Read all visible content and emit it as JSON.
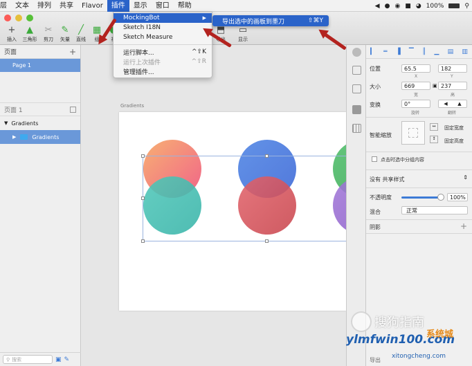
{
  "menubar": {
    "items": [
      "层",
      "文本",
      "排列",
      "共享",
      "Flavor",
      "插件",
      "显示",
      "窗口",
      "帮助"
    ],
    "active_index": 5,
    "battery": "100%"
  },
  "toolbar": {
    "tools": [
      {
        "label": "插入",
        "icon": "plus-icon"
      },
      {
        "label": "三角形",
        "icon": "triangle-icon"
      },
      {
        "label": "剪刀",
        "icon": "scissors-icon"
      },
      {
        "label": "矢量",
        "icon": "vector-pen-icon"
      },
      {
        "label": "直线",
        "icon": "line-icon"
      },
      {
        "label": "组",
        "icon": "group-icon"
      },
      {
        "label": "视",
        "icon": "view-icon"
      },
      {
        "label": "导出",
        "icon": "export-icon"
      },
      {
        "label": "显示",
        "icon": "display-icon"
      }
    ]
  },
  "plugin_menu": {
    "items": [
      {
        "label": "MockingBot",
        "shortcut": "",
        "has_submenu": true,
        "highlighted": true,
        "disabled": false
      },
      {
        "label": "Sketch I18N",
        "shortcut": "",
        "has_submenu": false,
        "highlighted": false,
        "disabled": false
      },
      {
        "label": "Sketch Measure",
        "shortcut": "",
        "has_submenu": false,
        "highlighted": false,
        "disabled": false
      },
      {
        "label": "运行脚本...",
        "shortcut": "^⇧K",
        "has_submenu": false,
        "highlighted": false,
        "disabled": false
      },
      {
        "label": "运行上次插件",
        "shortcut": "^⇧R",
        "has_submenu": false,
        "highlighted": false,
        "disabled": true
      },
      {
        "label": "管理插件...",
        "shortcut": "",
        "has_submenu": false,
        "highlighted": false,
        "disabled": false
      }
    ],
    "submenu": {
      "label": "导出选中的画板到墨刀",
      "shortcut": "⇧⌘Y"
    }
  },
  "left_panel": {
    "pages_title": "页面",
    "page": "Page 1",
    "layers_title": "页面 1",
    "layers": [
      {
        "name": "Gradients",
        "selected": false
      },
      {
        "name": "Gradients",
        "selected": true
      }
    ],
    "search_placeholder": "搜索"
  },
  "canvas": {
    "artboard_name": "Gradients",
    "circles": [
      {
        "group": 1,
        "top": "#f6a560",
        "bottom": "#ef4f78"
      },
      {
        "group": 1,
        "top": "#4fc7b9",
        "bottom": "#37b3a8"
      },
      {
        "group": 2,
        "top": "#4d84e4",
        "bottom": "#3a66d6"
      },
      {
        "group": 2,
        "top": "#e2636b",
        "bottom": "#c8444c"
      },
      {
        "group": 3,
        "top": "#4fbf6a",
        "bottom": "#3aa555"
      },
      {
        "group": 3,
        "top": "#a279d8",
        "bottom": "#8a5bc8"
      }
    ]
  },
  "inspector": {
    "position_label": "位置",
    "x_value": "65.5",
    "y_value": "182",
    "x_sub": "X",
    "y_sub": "Y",
    "size_label": "大小",
    "width_value": "669",
    "height_value": "237",
    "width_sub": "宽",
    "height_sub": "高",
    "transform_label": "变换",
    "rotation_value": "0°",
    "rotation_sub": "旋转",
    "flip_sub": "翻转",
    "resizing_label": "智能缩放",
    "fix_width": "固定宽度",
    "fix_height": "固定高度",
    "click_select_label": "点击时选中分组内容",
    "shared_style": "没有 共享样式",
    "opacity_label": "不透明度",
    "opacity_value": "100%",
    "blend_label": "混合",
    "blend_value": "正常",
    "shadow_label": "阴影",
    "export_label": "导出"
  },
  "watermark": {
    "brand1": "搜狗指南",
    "brand2": "ylmfwin100.com",
    "brand3": "xitongcheng.com",
    "brand4": "系统城"
  },
  "colors": {
    "menu_highlight": "#2a63c9",
    "selection": "#6a98d9",
    "annotation_arrow": "#b3231f"
  }
}
